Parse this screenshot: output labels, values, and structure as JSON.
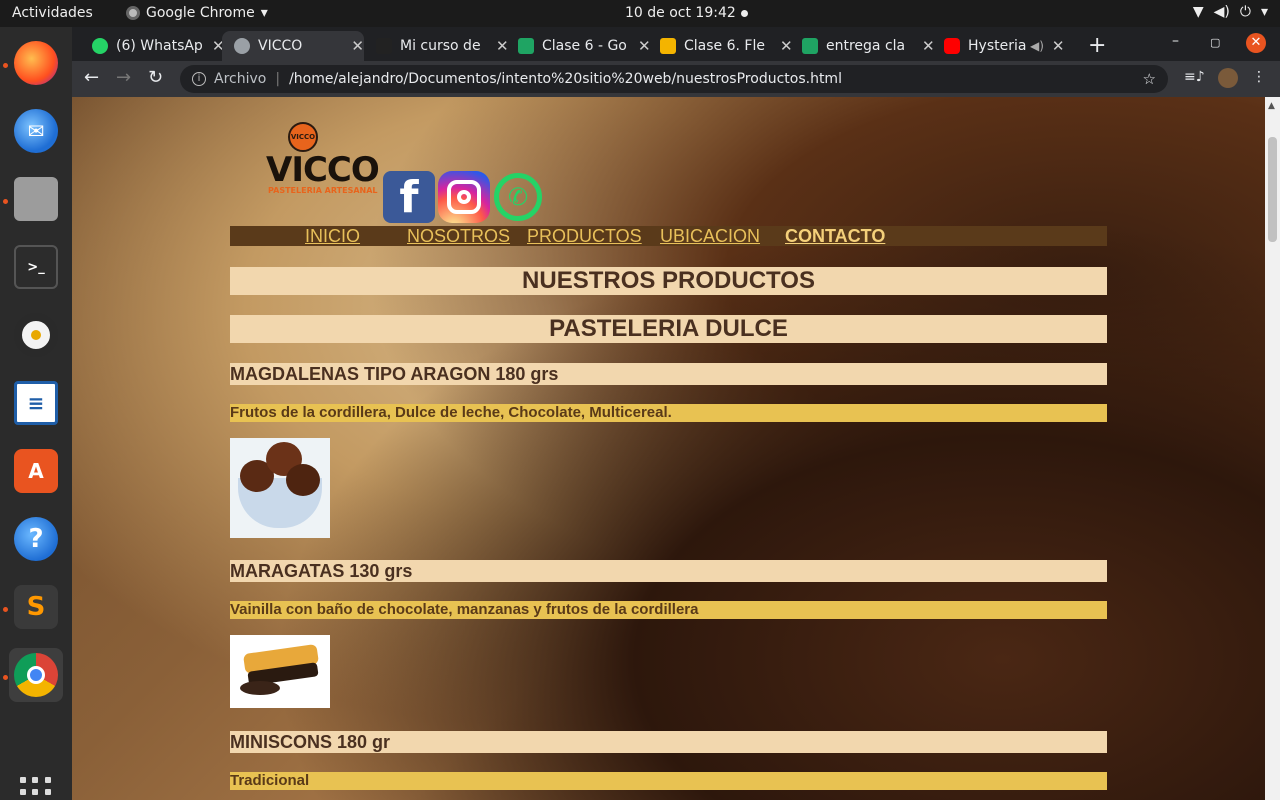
{
  "os": {
    "activities": "Actividades",
    "app_name": "Google Chrome",
    "clock": "10 de oct  19:42"
  },
  "tabs": [
    {
      "title": "(6) WhatsApp",
      "color": "#25d366"
    },
    {
      "title": "VICCO",
      "color": "#9aa0a6"
    },
    {
      "title": "Mi curso de",
      "color": "#222222"
    },
    {
      "title": "Clase 6 - Go",
      "color": "#1fa463"
    },
    {
      "title": "Clase 6. Fle",
      "color": "#f4b400"
    },
    {
      "title": "entrega cla",
      "color": "#1fa463"
    },
    {
      "title": "Hysteria",
      "color": "#ff0000"
    }
  ],
  "address": {
    "scheme_label": "Archivo",
    "url": "/home/alejandro/Documentos/intento%20sitio%20web/nuestrosProductos.html"
  },
  "site": {
    "logo_word": "VICCO",
    "logo_badge": "VICCO",
    "logo_sub": "PASTELERIA ARTESANAL",
    "menu": {
      "inicio": "INICIO",
      "nosotros": "NOSOTROS",
      "productos": "PRODUCTOS",
      "ubicacion": "UBICACION",
      "contacto": "CONTACTO"
    },
    "page_heading": "NUESTROS PRODUCTOS",
    "section_heading": "PASTELERIA DULCE",
    "products": [
      {
        "title": "MAGDALENAS TIPO ARAGON 180 grs",
        "desc": "Frutos de la cordillera, Dulce de leche, Chocolate, Multicereal."
      },
      {
        "title": "MARAGATAS 130 grs",
        "desc": "Vainilla con baño de chocolate, manzanas y frutos de la cordillera"
      },
      {
        "title": "MINISCONS 180 gr",
        "desc": "Tradicional"
      }
    ]
  }
}
